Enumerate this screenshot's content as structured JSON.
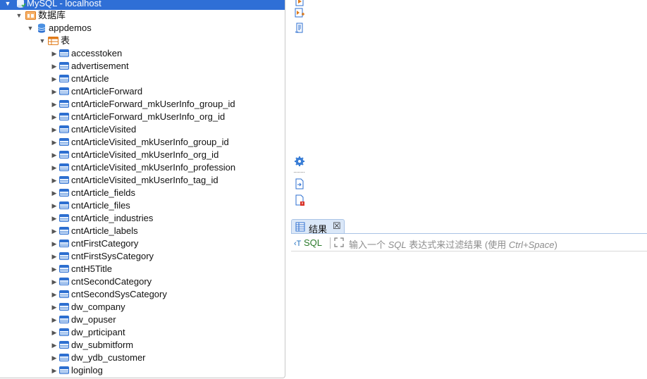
{
  "navigator": {
    "connection": "MySQL - localhost",
    "databases_label": "数据库",
    "database": "appdemos",
    "tables_label": "表",
    "tables": [
      "accesstoken",
      "advertisement",
      "cntArticle",
      "cntArticleForward",
      "cntArticleForward_mkUserInfo_group_id",
      "cntArticleForward_mkUserInfo_org_id",
      "cntArticleVisited",
      "cntArticleVisited_mkUserInfo_group_id",
      "cntArticleVisited_mkUserInfo_org_id",
      "cntArticleVisited_mkUserInfo_profession",
      "cntArticleVisited_mkUserInfo_tag_id",
      "cntArticle_fields",
      "cntArticle_files",
      "cntArticle_industries",
      "cntArticle_labels",
      "cntFirstCategory",
      "cntFirstSysCategory",
      "cntH5Title",
      "cntSecondCategory",
      "cntSecondSysCategory",
      "dw_company",
      "dw_opuser",
      "dw_prticipant",
      "dw_submitform",
      "dw_ydb_customer",
      "loginlog"
    ]
  },
  "results": {
    "tab_label": "结果",
    "close_glyph": "☒",
    "sql_label": "SQL",
    "filter_prefix": "输入一个 ",
    "filter_sql": "SQL",
    "filter_middle": " 表达式来过滤结果 (使用 ",
    "filter_shortcut": "Ctrl+Space",
    "filter_suffix": ")"
  },
  "icons": {
    "toolbar": [
      "execute-script-icon",
      "explain-plan-icon",
      "script-doc-icon",
      "settings-gear-icon",
      "export-doc-icon",
      "doc-error-icon"
    ]
  },
  "colors": {
    "selection": "#2f6fd6",
    "table_icon": "#2d6fd0",
    "folder_icon": "#e07b1a",
    "tab_bg": "#dbe8f8"
  }
}
